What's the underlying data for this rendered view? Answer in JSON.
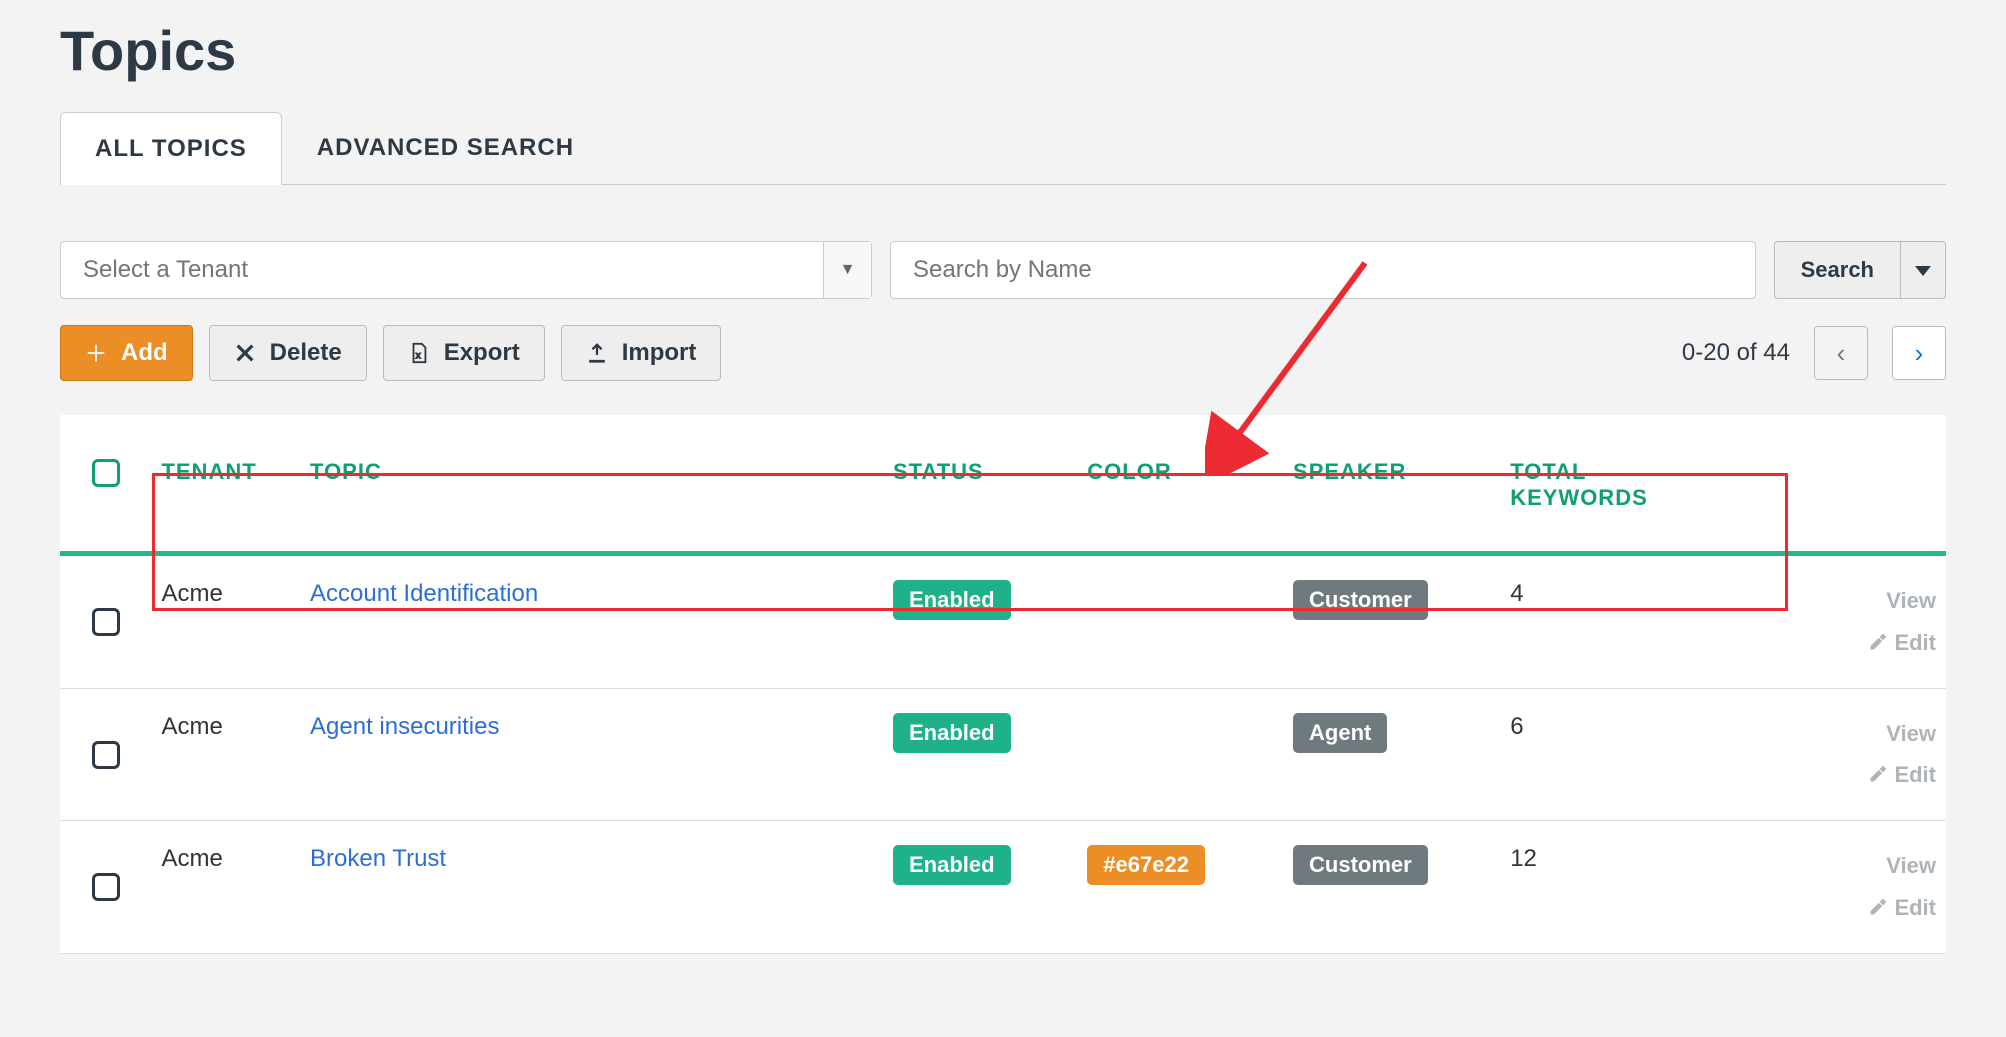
{
  "page_title": "Topics",
  "tabs": {
    "all_topics": "ALL TOPICS",
    "advanced_search": "ADVANCED SEARCH"
  },
  "filters": {
    "tenant_placeholder": "Select a Tenant",
    "search_placeholder": "Search by Name",
    "search_button": "Search"
  },
  "toolbar": {
    "add": "Add",
    "delete": "Delete",
    "export": "Export",
    "import": "Import"
  },
  "pagination": {
    "text": "0-20 of 44"
  },
  "columns": {
    "tenant": "TENANT",
    "topic": "TOPIC",
    "status": "STATUS",
    "color": "COLOR",
    "speaker": "SPEAKER",
    "total_keywords_line1": "TOTAL",
    "total_keywords_line2": "KEYWORDS"
  },
  "actions": {
    "view": "View",
    "edit": "Edit"
  },
  "rows": [
    {
      "tenant": "Acme",
      "topic": "Account Identification",
      "status": "Enabled",
      "color": "",
      "speaker": "Customer",
      "total_keywords": "4"
    },
    {
      "tenant": "Acme",
      "topic": "Agent insecurities",
      "status": "Enabled",
      "color": "",
      "speaker": "Agent",
      "total_keywords": "6"
    },
    {
      "tenant": "Acme",
      "topic": "Broken Trust",
      "status": "Enabled",
      "color": "#e67e22",
      "speaker": "Customer",
      "total_keywords": "12"
    }
  ]
}
